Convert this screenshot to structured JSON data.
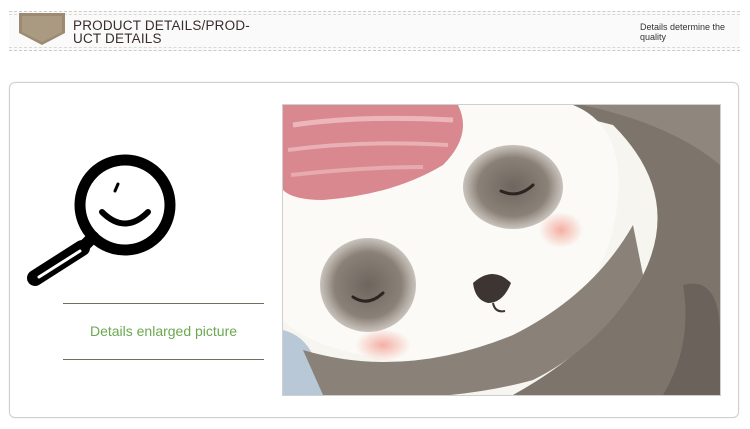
{
  "header": {
    "title_line1": "PRODUCT DETAILS/PROD-",
    "title_line2": "UCT DETAILS",
    "subtitle": "Details determine the quality",
    "tag_icon": "pennant-tag-icon",
    "tag_color": "#9c8a73"
  },
  "panel": {
    "icon": "magnifier-icon",
    "caption": "Details enlarged picture",
    "caption_color": "#6aa84f",
    "image": "sleeping-sloth-watercolor-closeup"
  }
}
